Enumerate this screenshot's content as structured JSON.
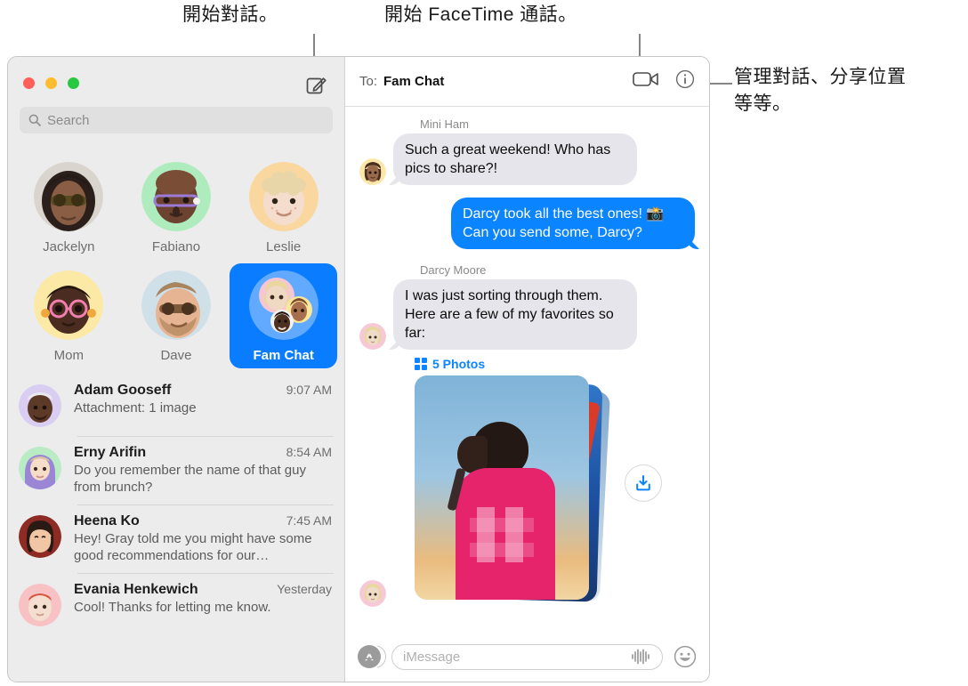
{
  "callouts": {
    "new_message": "開始對話。",
    "facetime": "開始 FaceTime 通話。",
    "details": "管理對話、分享位置\n等等。"
  },
  "sidebar": {
    "search": {
      "placeholder": "Search",
      "icon": "search-icon"
    },
    "compose_icon": "compose-icon",
    "window_controls": [
      "close",
      "minimize",
      "zoom"
    ],
    "pinned": [
      {
        "label": "Jackelyn",
        "selected": false
      },
      {
        "label": "Fabiano",
        "selected": false
      },
      {
        "label": "Leslie",
        "selected": false
      },
      {
        "label": "Mom",
        "selected": false
      },
      {
        "label": "Dave",
        "selected": false
      },
      {
        "label": "Fam Chat",
        "selected": true
      }
    ],
    "conversations": [
      {
        "name": "Adam Gooseff",
        "time": "9:07 AM",
        "preview": "Attachment: 1 image"
      },
      {
        "name": "Erny Arifin",
        "time": "8:54 AM",
        "preview": "Do you remember the name of that guy from brunch?"
      },
      {
        "name": "Heena Ko",
        "time": "7:45 AM",
        "preview": "Hey! Gray told me you might have some good recommendations for our…"
      },
      {
        "name": "Evania Henkewich",
        "time": "Yesterday",
        "preview": "Cool! Thanks for letting me know."
      }
    ]
  },
  "thread": {
    "to_label": "To:",
    "to_value": "Fam Chat",
    "facetime_icon": "video-camera-icon",
    "details_icon": "info-circle-icon",
    "messages": [
      {
        "sender": "Mini Ham",
        "text": "Such a great weekend! Who has pics to share?!",
        "direction": "in"
      },
      {
        "sender": "",
        "text": "Darcy took all the best ones! 📸 Can you send some, Darcy?",
        "direction": "out"
      },
      {
        "sender": "Darcy Moore",
        "text": "I was just sorting through them. Here are a few of my favorites so far:",
        "direction": "in"
      }
    ],
    "attachment": {
      "badge_label": "5 Photos",
      "badge_icon": "photos-grid-icon",
      "save_icon": "save-download-icon"
    },
    "composer": {
      "apps_icon": "app-store-icon",
      "input_placeholder": "iMessage",
      "audio_icon": "audio-waveform-icon",
      "emoji_icon": "smiley-face-icon"
    }
  },
  "colors": {
    "accent_blue": "#0b84ff",
    "selected_tile": "#0a7cff",
    "incoming_bubble": "#e6e5eb",
    "window_chrome": "#ececec"
  }
}
